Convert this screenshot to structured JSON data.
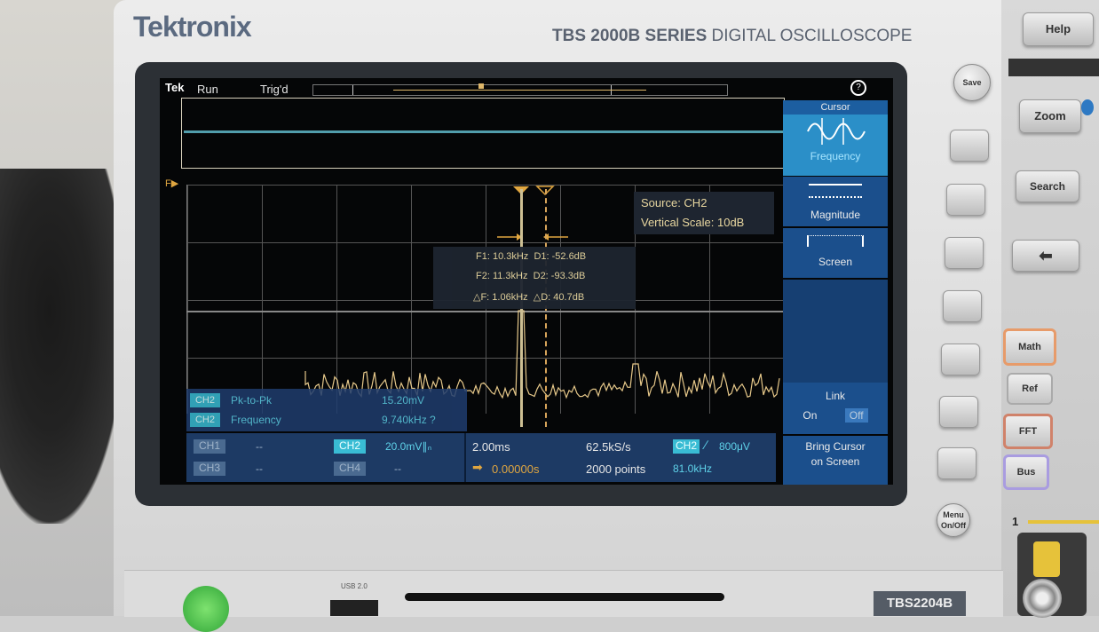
{
  "brand": {
    "logo": "Tektronix",
    "series_bold": "TBS 2000B SERIES",
    "series_rest": "DIGITAL OSCILLOSCOPE",
    "model_badge": "TBS2204B",
    "usb_label": "USB 2.0"
  },
  "screen": {
    "top_bar": {
      "logo": "Tek",
      "run_state": "Run",
      "trigger_state": "Trig'd"
    },
    "source_info": {
      "source": "Source: CH2",
      "vertical_scale": "Vertical Scale: 10dB"
    },
    "readout": {
      "f1": "F1: 10.3kHz",
      "d1": "D1: -52.6dB",
      "f2": "F2: 11.3kHz",
      "d2": "D2: -93.3dB",
      "df": "△F: 1.06kHz",
      "dd": "△D: 40.7dB"
    },
    "marker_left": "F▶",
    "side_menu": {
      "title": "Cursor",
      "frequency": "Frequency",
      "magnitude": "Magnitude",
      "screen": "Screen",
      "link": "Link",
      "link_on": "On",
      "link_off": "Off",
      "bring_cursor": "Bring Cursor on Screen"
    },
    "measurements": [
      {
        "channel": "CH2",
        "name": "Pk-to-Pk",
        "value": "15.20mV"
      },
      {
        "channel": "CH2",
        "name": "Frequency",
        "value": "9.740kHz ?"
      }
    ],
    "status": {
      "ch1": "CH1",
      "ch1_val": "--",
      "ch3": "CH3",
      "ch3_val": "--",
      "ch2": "CH2",
      "ch2_val": "20.0mV∥ₙ",
      "ch4": "CH4",
      "ch4_val": "--",
      "timebase": "2.00ms",
      "position": "0.00000s",
      "sample_rate": "62.5kS/s",
      "points": "2000 points",
      "trigger_ch": "CH2",
      "trigger_level": "800μV",
      "trigger_freq": "81.0kHz"
    }
  },
  "hardware": {
    "help": "Help",
    "save": "Save",
    "zoom": "Zoom",
    "search": "Search",
    "math": "Math",
    "ref": "Ref",
    "fft": "FFT",
    "bus": "Bus",
    "menu": "Menu On/Off",
    "channel_num": "1"
  },
  "colors": {
    "accent_cyan": "#39bcd4",
    "trace": "#e6c88a",
    "menu_blue": "#1e56a0"
  }
}
